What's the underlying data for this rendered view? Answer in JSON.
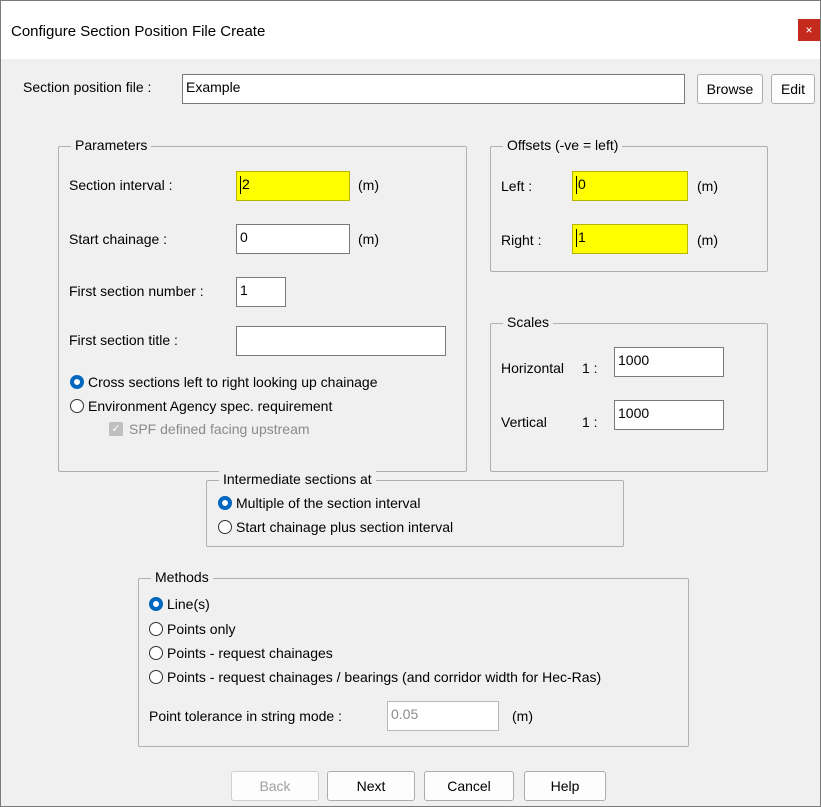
{
  "window": {
    "title": "Configure Section Position File Create",
    "close_glyph": "×"
  },
  "file": {
    "label": "Section position file :",
    "value": "Example",
    "browse_label": "Browse",
    "edit_label": "Edit"
  },
  "parameters": {
    "title": "Parameters",
    "section_interval_label": "Section interval :",
    "section_interval_value": "2",
    "section_interval_unit": "(m)",
    "start_chainage_label": "Start chainage :",
    "start_chainage_value": "0",
    "start_chainage_unit": "(m)",
    "first_section_number_label": "First section number :",
    "first_section_number_value": "1",
    "first_section_title_label": "First section title :",
    "first_section_title_value": "",
    "radio_cross_sections": "Cross sections left to right looking up chainage",
    "radio_environment_agency": "Environment Agency spec. requirement",
    "spf_checkbox_label": "SPF defined facing upstream"
  },
  "offsets": {
    "title": "Offsets (-ve = left)",
    "left_label": "Left :",
    "left_value": "0",
    "left_unit": "(m)",
    "right_label": "Right :",
    "right_value": "1",
    "right_unit": "(m)"
  },
  "scales": {
    "title": "Scales",
    "horizontal_label": "Horizontal",
    "horizontal_prefix": "1 :",
    "horizontal_value": "1000",
    "vertical_label": "Vertical",
    "vertical_prefix": "1 :",
    "vertical_value": "1000"
  },
  "intermediate": {
    "title": "Intermediate sections at",
    "option_multiple": "Multiple of the section interval",
    "option_start_plus": "Start chainage plus section interval"
  },
  "methods": {
    "title": "Methods",
    "option_lines": "Line(s)",
    "option_points_only": "Points only",
    "option_points_chainages": "Points - request chainages",
    "option_points_bearings": "Points - request chainages / bearings (and corridor width for Hec-Ras)",
    "tolerance_label": "Point tolerance in string mode :",
    "tolerance_value": "0.05",
    "tolerance_unit": "(m)"
  },
  "buttons": {
    "back": "Back",
    "next": "Next",
    "cancel": "Cancel",
    "help": "Help"
  },
  "colors": {
    "highlight": "#ffff00",
    "radio_accent": "#0067c0",
    "close_button": "#c42b1c"
  }
}
